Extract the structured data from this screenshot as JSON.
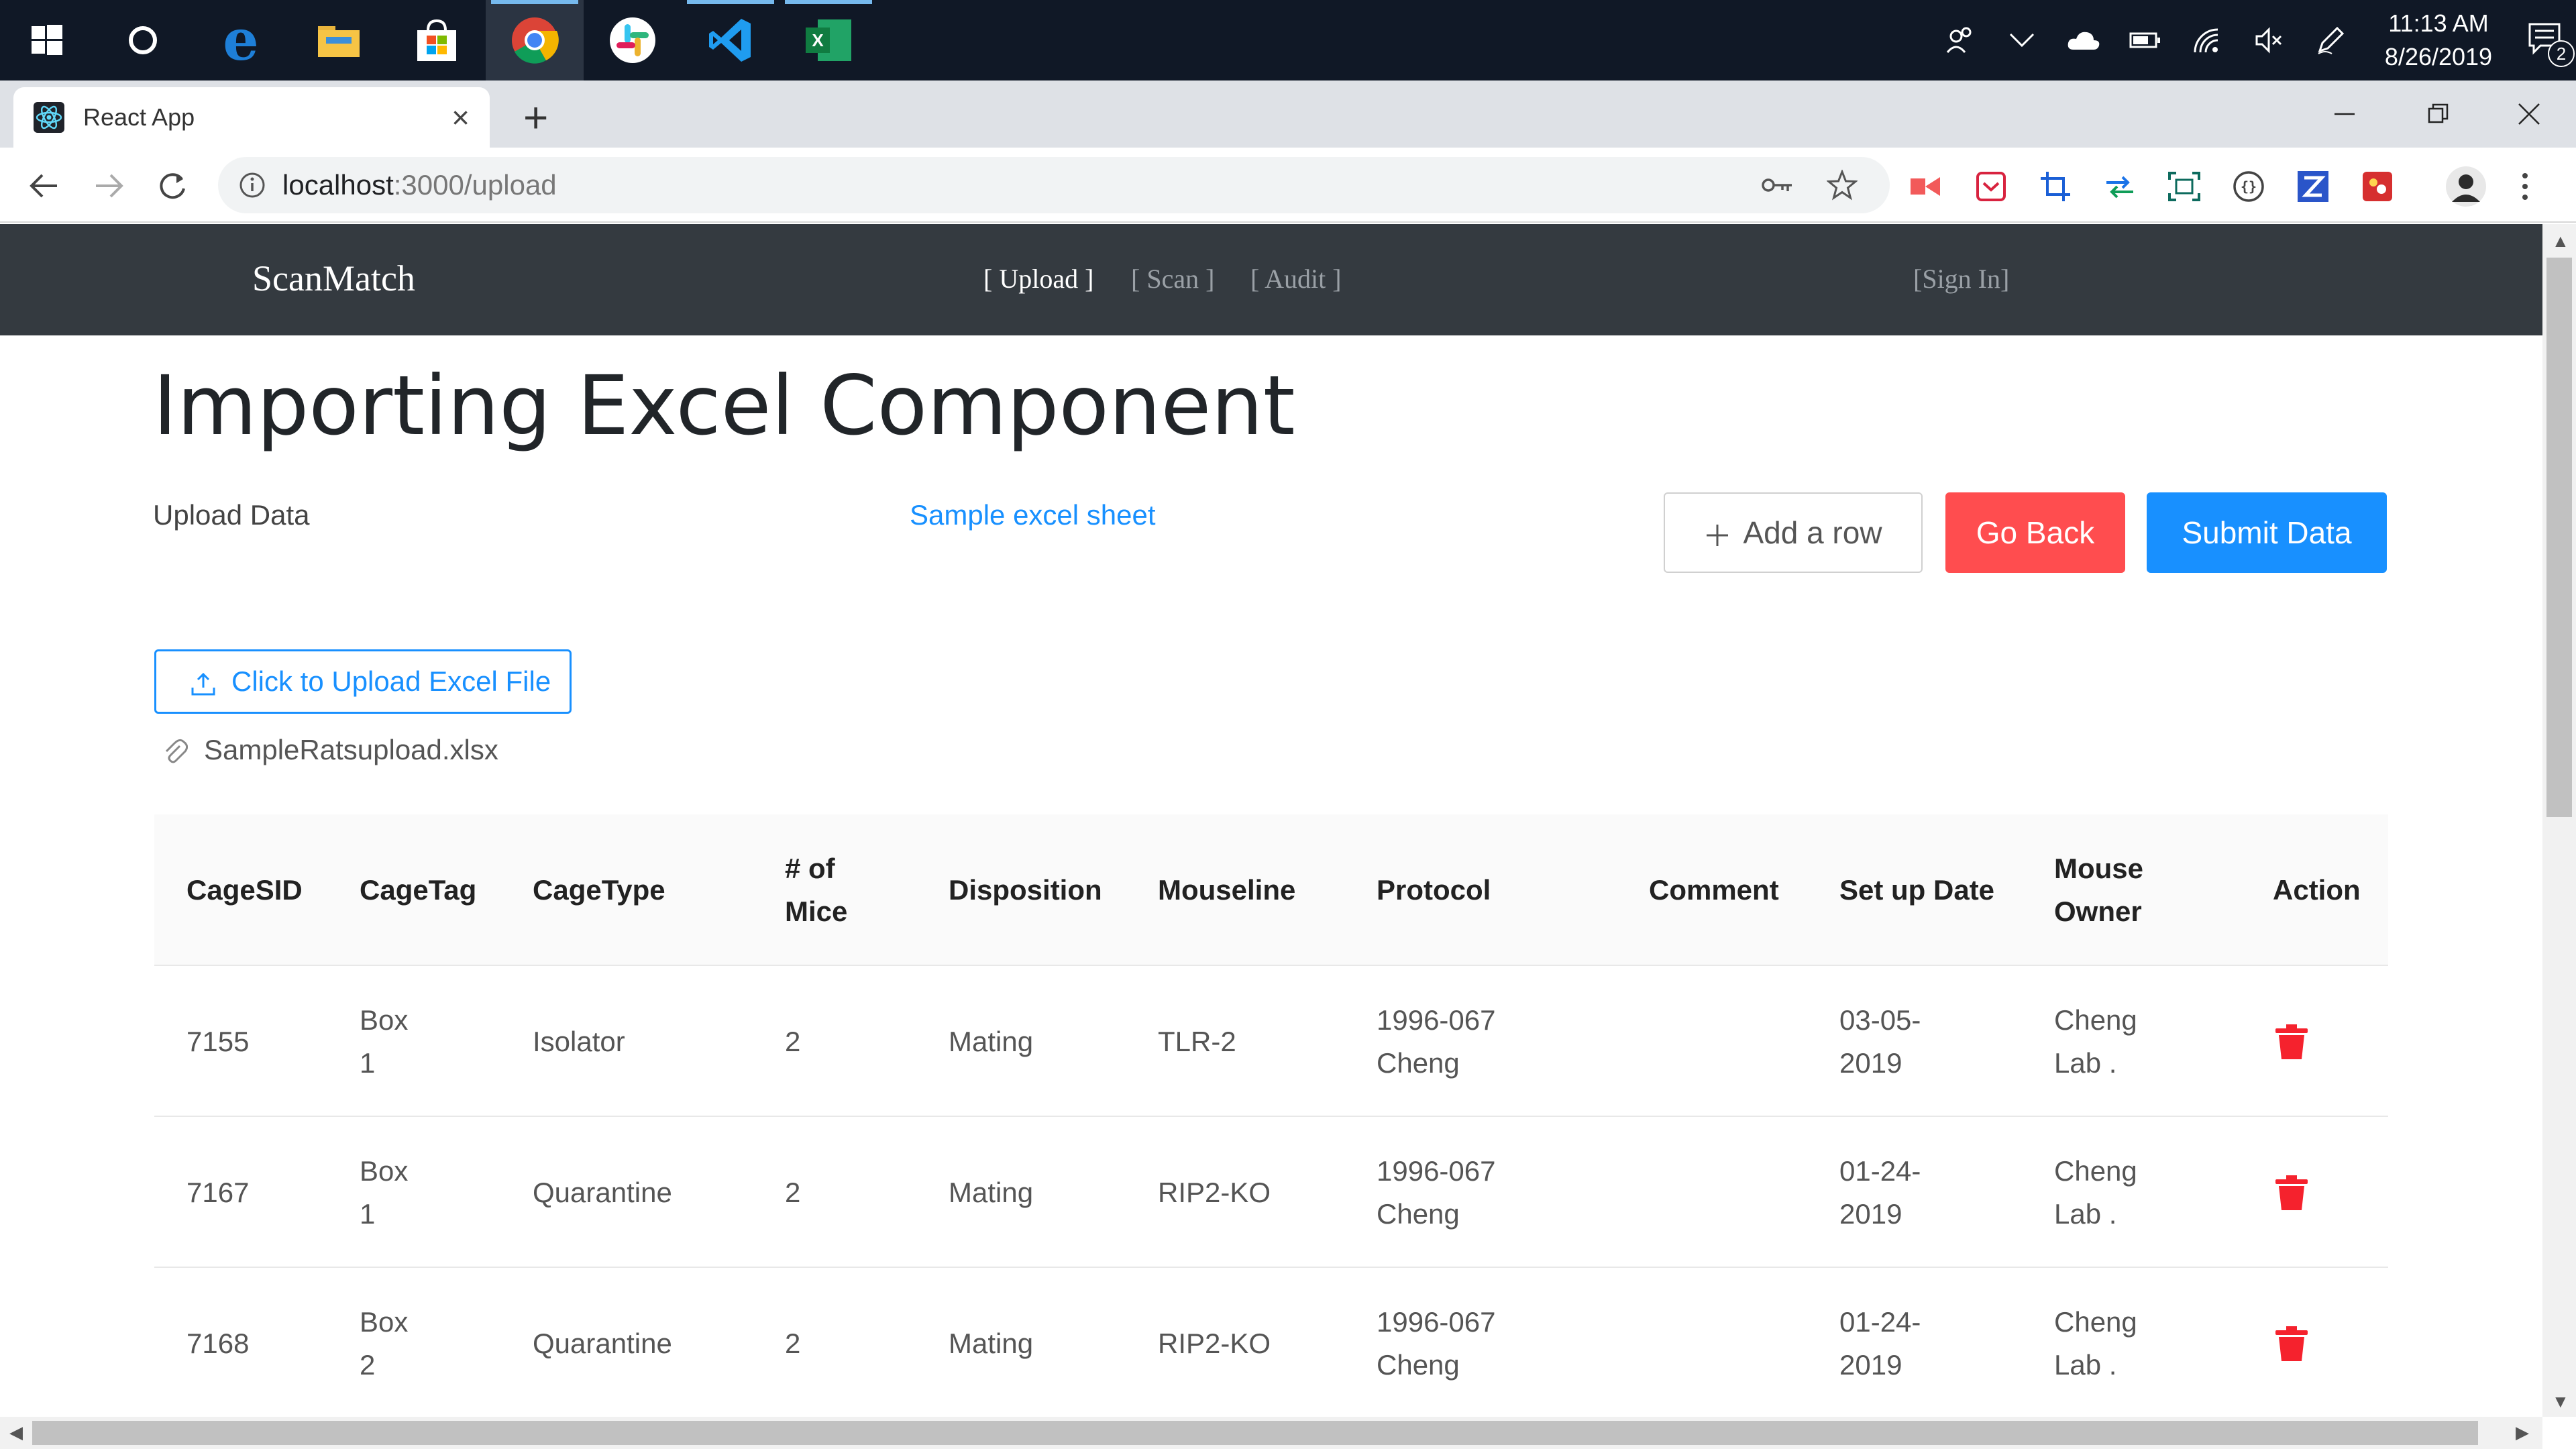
{
  "taskbar": {
    "apps": [
      {
        "icon": "windows-start-icon"
      },
      {
        "icon": "cortana-icon"
      },
      {
        "icon": "edge-icon"
      },
      {
        "icon": "file-explorer-icon"
      },
      {
        "icon": "store-icon"
      },
      {
        "icon": "chrome-icon"
      },
      {
        "icon": "slack-icon"
      },
      {
        "icon": "vscode-icon"
      },
      {
        "icon": "excel-icon"
      }
    ],
    "time": "11:13 AM",
    "date": "8/26/2019",
    "notification_count": "2"
  },
  "browser": {
    "tab_title": "React App",
    "url_host": "localhost",
    "url_rest": ":3000/upload"
  },
  "app": {
    "brand": "ScanMatch",
    "nav": {
      "upload": "[ Upload ]",
      "scan": "[ Scan ]",
      "audit": "[ Audit ]",
      "signin": "[Sign In]"
    }
  },
  "page": {
    "title": "Importing Excel Component",
    "upload_label": "Upload Data",
    "sample_link": "Sample excel sheet",
    "add_row": "Add a row",
    "go_back": "Go Back",
    "submit": "Submit Data",
    "upload_button": "Click to Upload Excel File",
    "file_name": "SampleRatsupload.xlsx"
  },
  "table": {
    "headers": {
      "cage_sid": "CageSID",
      "cage_tag": "CageTag",
      "cage_type": "CageType",
      "mice_1": "# of",
      "mice_2": "Mice",
      "disposition": "Disposition",
      "mouseline": "Mouseline",
      "protocol": "Protocol",
      "comment": "Comment",
      "setup_date": "Set up Date",
      "owner_1": "Mouse",
      "owner_2": "Owner",
      "action": "Action"
    },
    "rows": [
      {
        "cage_sid": "7155",
        "tag_1": "Box",
        "tag_2": "1",
        "cage_type": "Isolator",
        "mice": "2",
        "disposition": "Mating",
        "mouseline": "TLR-2",
        "protocol_1": "1996-067",
        "protocol_2": "Cheng",
        "comment": "",
        "date_1": "03-05-",
        "date_2": "2019",
        "owner_1": "Cheng",
        "owner_2": "Lab ."
      },
      {
        "cage_sid": "7167",
        "tag_1": "Box",
        "tag_2": "1",
        "cage_type": "Quarantine",
        "mice": "2",
        "disposition": "Mating",
        "mouseline": "RIP2-KO",
        "protocol_1": "1996-067",
        "protocol_2": "Cheng",
        "comment": "",
        "date_1": "01-24-",
        "date_2": "2019",
        "owner_1": "Cheng",
        "owner_2": "Lab ."
      },
      {
        "cage_sid": "7168",
        "tag_1": "Box",
        "tag_2": "2",
        "cage_type": "Quarantine",
        "mice": "2",
        "disposition": "Mating",
        "mouseline": "RIP2-KO",
        "protocol_1": "1996-067",
        "protocol_2": "Cheng",
        "comment": "",
        "date_1": "01-24-",
        "date_2": "2019",
        "owner_1": "Cheng",
        "owner_2": "Lab ."
      }
    ]
  },
  "colors": {
    "navbar": "#343a40",
    "primary": "#1890ff",
    "danger": "#ff4d4f",
    "delete_icon": "#f5222d"
  }
}
